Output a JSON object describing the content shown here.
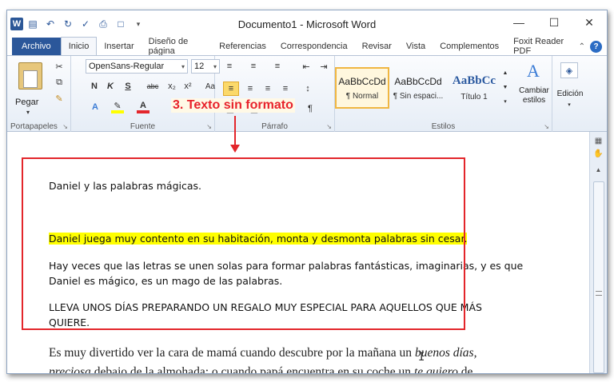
{
  "window": {
    "title": "Documento1 - Microsoft Word",
    "app_icon": "W"
  },
  "tabs": [
    {
      "label": "Archivo",
      "type": "file"
    },
    {
      "label": "Inicio",
      "active": true
    },
    {
      "label": "Insertar"
    },
    {
      "label": "Diseño de página"
    },
    {
      "label": "Referencias"
    },
    {
      "label": "Correspondencia"
    },
    {
      "label": "Revisar"
    },
    {
      "label": "Vista"
    },
    {
      "label": "Complementos"
    },
    {
      "label": "Foxit Reader PDF"
    }
  ],
  "ribbon": {
    "clipboard": {
      "label": "Portapapeles",
      "paste": "Pegar"
    },
    "font": {
      "label": "Fuente",
      "name": "OpenSans-Regular",
      "size": "12",
      "bold": "N",
      "italic": "K",
      "underline": "S"
    },
    "paragraph": {
      "label": "Párrafo"
    },
    "styles": {
      "label": "Estilos",
      "items": [
        {
          "sample": "AaBbCcDd",
          "name": "¶ Normal"
        },
        {
          "sample": "AaBbCcDd",
          "name": "¶ Sin espaci..."
        },
        {
          "sample": "AaBbCc",
          "name": "Título 1"
        }
      ],
      "change": "Cambiar estilos"
    },
    "edit": {
      "label": "Edición"
    }
  },
  "annotation": {
    "label": "3. Texto sin formato"
  },
  "document": {
    "title": "Daniel y las palabras mágicas.",
    "highlighted": "Daniel juega muy contento en su habitación, monta y desmonta palabras sin cesar.",
    "para1_line1": "Hay veces que las letras se unen solas para formar palabras fantásticas, imaginarias, y es que",
    "para1_line2": "Daniel es mágico, es un mago de las palabras.",
    "para2_line1": "LLEVA UNOS DÍAS PREPARANDO UN REGALO MUY ESPECIAL PARA AQUELLOS QUE MÁS",
    "para2_line2": "QUIERE.",
    "serif_line1_a": "Es muy divertido ver la cara de mamá cuando descubre por la mañana un ",
    "serif_line1_b": "buenos días,",
    "serif_line2_a": "preciosa",
    "serif_line2_b": " debajo de la almohada; o cuando papá encuentra en su coche un ",
    "serif_line2_c": "te quiero",
    "serif_line2_d": " de"
  },
  "colors": {
    "accent": "#2b579a",
    "annotation": "#e3262b",
    "highlight": "#ffff00"
  }
}
